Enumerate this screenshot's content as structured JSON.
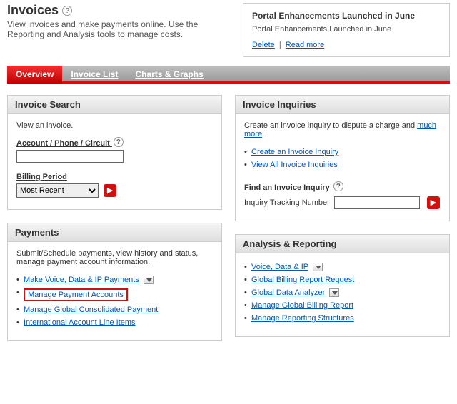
{
  "header": {
    "title": "Invoices",
    "subtitle": "View invoices and make payments online. Use the Reporting and Analysis tools to manage costs."
  },
  "portal": {
    "title": "Portal Enhancements Launched in June",
    "body": "Portal Enhancements Launched in June",
    "delete": "Delete",
    "readmore": "Read more"
  },
  "tabs": {
    "overview": "Overview",
    "invoice_list": "Invoice List",
    "charts": "Charts & Graphs"
  },
  "invoice_search": {
    "title": "Invoice Search",
    "desc": "View an invoice.",
    "acct_label": "Account / Phone / Circuit",
    "acct_value": "",
    "billing_label": "Billing Period",
    "billing_value": "Most Recent"
  },
  "payments": {
    "title": "Payments",
    "desc": "Submit/Schedule payments, view history and status, manage payment account information.",
    "l1": "Make Voice, Data & IP Payments",
    "l2": "Manage Payment Accounts",
    "l3": "Manage Global Consolidated Payment",
    "l4": "International Account Line Items"
  },
  "inquiries": {
    "title": "Invoice Inquiries",
    "desc_pre": "Create an invoice inquiry to dispute a charge and ",
    "desc_link": "much more",
    "desc_post": ".",
    "l1": "Create an Invoice Inquiry",
    "l2": "View All Invoice Inquiries",
    "find_label": "Find an Invoice Inquiry",
    "track_label": "Inquiry Tracking Number",
    "track_value": ""
  },
  "analysis": {
    "title": "Analysis & Reporting",
    "l1": "Voice, Data & IP",
    "l2": "Global Billing Report Request",
    "l3": "Global Data Analyzer",
    "l4": "Manage Global Billing Report",
    "l5": "Manage Reporting Structures"
  }
}
